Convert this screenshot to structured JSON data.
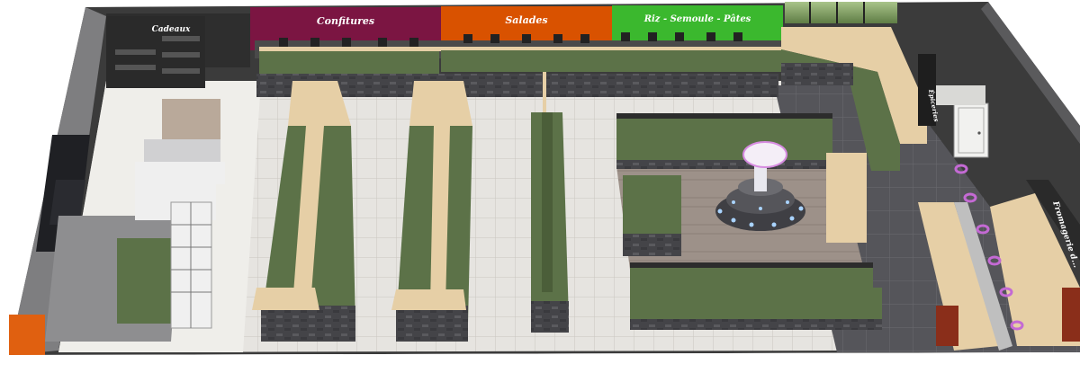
{
  "signs": {
    "cadeaux": "Cadeaux",
    "confitures": "Confitures",
    "salades": "Salades",
    "riz": "Riz - Semoule - Pâtes",
    "epicerie": "Épiceries",
    "fromagerie": "Fromagerie d..."
  },
  "colors": {
    "wall_dark": "#3a3a3a",
    "floor_tile": "#e4e2de",
    "floor_dark": "#55555a",
    "floor_wood": "#9c8f84",
    "sign_purple": "#7b1542",
    "sign_orange": "#d95200",
    "sign_green": "#3bb82e",
    "shelf_green": "#5c7248",
    "wood": "#e6cfa6",
    "stone": "#4a4a4e",
    "fountain_glow": "#d68be0"
  },
  "icons": [
    "fountain-icon",
    "door-icon",
    "window-icon",
    "stool-icon"
  ]
}
